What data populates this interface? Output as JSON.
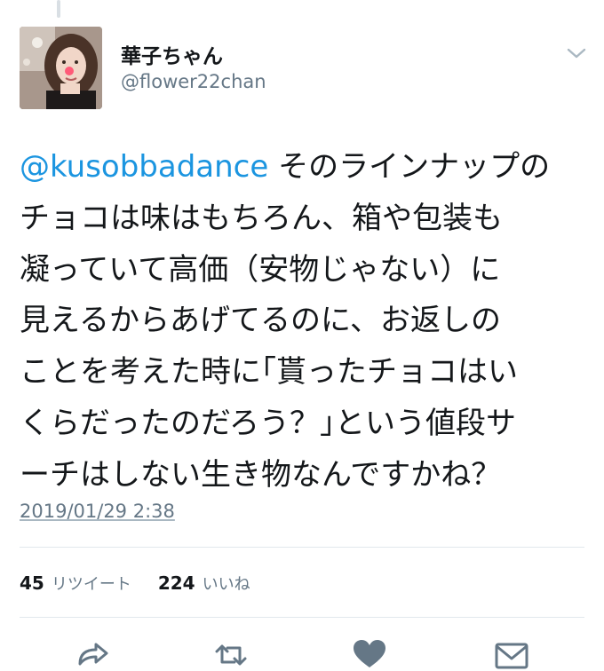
{
  "tweet": {
    "display_name": "華子ちゃん",
    "handle": "@flower22chan",
    "mention": "@kusobbadance",
    "text_lines": [
      " そのラインナップの",
      "チョコは味はもちろん、箱や包装も",
      "凝っていて高価（安物じゃない）に",
      "見えるからあげてるのに、お返しの",
      "ことを考えた時に｢貰ったチョコはい",
      "くらだったのだろう？｣という値段サ",
      "ーチはしない生き物なんですかね？"
    ],
    "timestamp": "2019/01/29 2:38",
    "retweet_count": "45",
    "retweet_label": "リツイート",
    "like_count": "224",
    "like_label": "いいね"
  },
  "icons": {
    "menu": "chevron-down-icon",
    "reply": "reply-icon",
    "retweet": "retweet-icon",
    "like": "heart-icon",
    "share": "envelope-icon"
  },
  "colors": {
    "mention": "#1b95e0",
    "secondary_text": "#657786",
    "primary_text": "#14171a",
    "divider": "#e1e8ed"
  }
}
